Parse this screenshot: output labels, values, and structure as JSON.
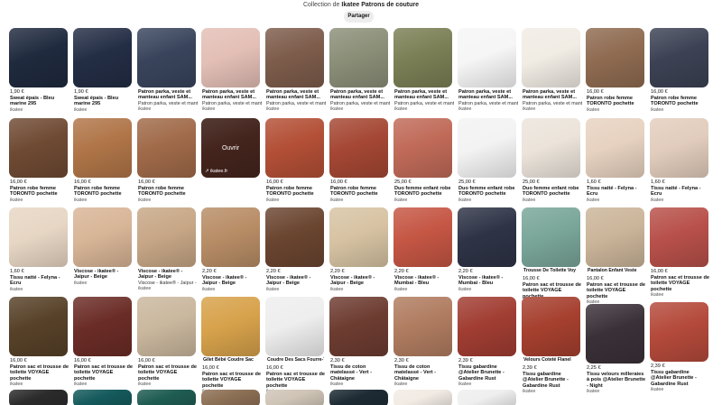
{
  "header": {
    "collection_prefix": "Collection de",
    "collection_name": "Ikatee Patrons de couture",
    "share_label": "Partager"
  },
  "pins_open_label": "Ouvrir",
  "pins_source_domain": "ikatee.fr",
  "columns": [
    [
      {
        "color": "#1f2a3e",
        "price": "1,90 €",
        "title": "Sweat épais - Bleu marine 295",
        "desc": "",
        "source": "ikatee"
      },
      {
        "color": "#6f4a33",
        "price": "16,00 €",
        "title": "Patron robe femme TORONTO pochette",
        "desc": "",
        "source": "ikatee"
      },
      {
        "color": "#e7d6c4",
        "price": "1,60 €",
        "title": "Tissu natté - Felyna - Ecru",
        "desc": "",
        "source": "ikatee"
      },
      {
        "color": "#574128",
        "price": "16,00 €",
        "title": "Patron sac et trousse de toilette VOYAGE pochette",
        "desc": "",
        "source": "ikatee"
      },
      {
        "color": "#2b2b2b",
        "price": "",
        "title": "",
        "desc": "",
        "source": ""
      }
    ],
    [
      {
        "color": "#232d44",
        "price": "1,90 €",
        "title": "Sweat épais - Bleu marine 295",
        "desc": "",
        "source": "ikatee"
      },
      {
        "color": "#b07548",
        "price": "16,00 €",
        "title": "Patron robe femme TORONTO pochette",
        "desc": "",
        "source": "ikatee"
      },
      {
        "color": "#d8b597",
        "price": "",
        "title": "Viscose - ikatee® - Jaipur - Beige",
        "desc": "",
        "source": "ikatee"
      },
      {
        "color": "#6b2c26",
        "price": "16,00 €",
        "title": "Patron sac et trousse de toilette VOYAGE pochette",
        "desc": "",
        "source": "ikatee"
      },
      {
        "color": "#155a5c",
        "price": "",
        "title": "",
        "desc": "",
        "source": ""
      }
    ],
    [
      {
        "color": "#39445c",
        "price": "",
        "title": "Patron parka, veste et manteau enfant SAM...",
        "desc": "Patron parka, veste et manteau enfant SAM...",
        "source": "ikatee"
      },
      {
        "color": "#a06a49",
        "price": "16,00 €",
        "title": "Patron robe femme TORONTO pochette",
        "desc": "",
        "source": "ikatee"
      },
      {
        "color": "#c7a786",
        "price": "",
        "title": "Viscose - ikatee® - Jaipur - Beige",
        "desc": "Viscose - ikatee® - Jaipur - Beige",
        "source": "ikatee"
      },
      {
        "color": "#cab79e",
        "price": "16,00 €",
        "title": "Patron sac et trousse de toilette VOYAGE pochette",
        "desc": "",
        "source": "ikatee"
      },
      {
        "color": "#1f5c52",
        "price": "",
        "title": "",
        "desc": "",
        "source": ""
      }
    ],
    [
      {
        "color": "#e3bfb6",
        "price": "",
        "title": "Patron parka, veste et manteau enfant SAM...",
        "desc": "Patron parka, veste et manteau enfant SAM...",
        "source": "ikatee"
      },
      {
        "color": "#6e3b2f",
        "price": "",
        "title": "",
        "desc": "",
        "source": ""
      },
      {
        "color": "#b88d66",
        "price": "2,20 €",
        "title": "Viscose - ikatee® - Jaipur - Beige",
        "desc": "",
        "source": "ikatee"
      },
      {
        "color": "#d7a24b",
        "tag": "Gilet Bébé   Coudre Sac",
        "price": "16,00 €",
        "title": "Patron sac et trousse de toilette VOYAGE pochette",
        "desc": "",
        "source": "ikatee"
      },
      {
        "color": "#8c6f54",
        "price": "",
        "title": "",
        "desc": "",
        "source": ""
      }
    ],
    [
      {
        "color": "#7d5c4b",
        "price": "",
        "title": "Patron parka, veste et manteau enfant SAM...",
        "desc": "Patron parka, veste et manteau enfant SAM...",
        "source": "ikatee"
      },
      {
        "color": "#b34f36",
        "price": "16,00 €",
        "title": "Patron robe femme TORONTO pochette",
        "desc": "",
        "source": "ikatee"
      },
      {
        "color": "#6a4530",
        "price": "2,20 €",
        "title": "Viscose - ikatee® - Jaipur - Beige",
        "desc": "",
        "source": "ikatee"
      },
      {
        "color": "#eeeeee",
        "tag": "Coudre Des Sacs Fourre-T",
        "price": "16,00 €",
        "title": "Patron sac et trousse de toilette VOYAGE pochette",
        "desc": "",
        "source": "ikatee"
      },
      {
        "color": "#cfc4b6",
        "price": "",
        "title": "",
        "desc": "",
        "source": ""
      }
    ],
    [
      {
        "color": "#8b8f78",
        "price": "",
        "title": "Patron parka, veste et manteau enfant SAM...",
        "desc": "Patron parka, veste et manteau enfant SAM...",
        "source": "ikatee"
      },
      {
        "color": "#a54734",
        "price": "16,00 €",
        "title": "Patron robe femme TORONTO pochette",
        "desc": "",
        "source": "ikatee"
      },
      {
        "color": "#d7c3a3",
        "price": "2,20 €",
        "title": "Viscose - ikatee® - Jaipur - Beige",
        "desc": "",
        "source": "ikatee"
      },
      {
        "color": "#6d3c31",
        "price": "2,30 €",
        "title": "Tissu de coton matelassé - Vert - Châtaigne",
        "desc": "",
        "source": "ikatee"
      },
      {
        "color": "#1d2b34",
        "price": "",
        "title": "",
        "desc": "",
        "source": ""
      }
    ],
    [
      {
        "color": "#7b7f55",
        "price": "",
        "title": "Patron parka, veste et manteau enfant SAM...",
        "desc": "Patron parka, veste et manteau enfant SAM...",
        "source": "ikatee"
      },
      {
        "color": "#c06a58",
        "price": "25,00 €",
        "title": "Duo femme enfant robe TORONTO pochette",
        "desc": "",
        "source": "ikatee"
      },
      {
        "color": "#c55644",
        "price": "2,20 €",
        "title": "Viscose - ikatee® - Mumbai - Bleu",
        "desc": "",
        "source": "ikatee"
      },
      {
        "color": "#b07c60",
        "price": "2,30 €",
        "title": "Tissu de coton matelassé - Vert - Châtaigne",
        "desc": "",
        "source": "ikatee"
      },
      {
        "color": "#f2ebe4",
        "price": "",
        "title": "",
        "desc": "",
        "source": ""
      }
    ],
    [
      {
        "color": "#f6f6f6",
        "price": "",
        "title": "Patron parka, veste et manteau enfant SAM...",
        "desc": "Patron parka, veste et manteau enfant SAM...",
        "source": "ikatee"
      },
      {
        "color": "#f3f3f3",
        "price": "25,00 €",
        "title": "Duo femme enfant robe TORONTO pochette",
        "desc": "",
        "source": "ikatee"
      },
      {
        "color": "#2e3346",
        "price": "2,20 €",
        "title": "Viscose - ikatee® - Mumbai - Bleu",
        "desc": "",
        "source": "ikatee"
      },
      {
        "color": "#a13d32",
        "price": "2,39 €",
        "title": "Tissu gabardine @Atelier Brunette - Gabardine Rust",
        "desc": "",
        "source": "ikatee"
      },
      {
        "color": "#efefef",
        "price": "",
        "title": "",
        "desc": "",
        "source": ""
      }
    ],
    [
      {
        "color": "#f1ece4",
        "price": "",
        "title": "Patron parka, veste et manteau enfant SAM...",
        "desc": "Patron parka, veste et manteau enfant SAM...",
        "source": "ikatee"
      },
      {
        "color": "#ece4db",
        "price": "25,00 €",
        "title": "Duo femme enfant robe TORONTO pochette",
        "desc": "",
        "source": "ikatee"
      },
      {
        "color": "#7aa69a",
        "tag": "Trousse De Toilette Voy",
        "price": "16,00 €",
        "title": "Patron sac et trousse de toilette VOYAGE pochette",
        "desc": "",
        "source": "ikatee"
      },
      {
        "color": "#a6402f",
        "tag": "Velours Coteté   Flanel",
        "price": "2,39 €",
        "title": "Tissu gabardine @Atelier Brunette - Gabardine Rust",
        "desc": "",
        "source": "ikatee"
      }
    ],
    [
      {
        "color": "#8f6b51",
        "price": "16,00 €",
        "title": "Patron robe femme TORONTO pochette",
        "desc": "",
        "source": "ikatee"
      },
      {
        "color": "#e7d2c0",
        "price": "1,60 €",
        "title": "Tissu natté - Felyna - Ecru",
        "desc": "",
        "source": "ikatee"
      },
      {
        "color": "#cbb59a",
        "tag": "Pantalon Enfant   Veste",
        "price": "16,00 €",
        "title": "Patron sac et trousse de toilette VOYAGE pochette",
        "desc": "",
        "source": "ikatee"
      },
      {
        "color": "#3a3138",
        "price": "2,25 €",
        "title": "Tissu velours milleraies à pois @Atelier Brunette - Night",
        "desc": "",
        "source": "ikatee"
      }
    ],
    [
      {
        "color": "#3c4254",
        "price": "16,00 €",
        "title": "Patron robe femme TORONTO pochette",
        "desc": "",
        "source": "ikatee"
      },
      {
        "color": "#e2cdbd",
        "price": "1,60 €",
        "title": "Tissu natté - Felyna - Ecru",
        "desc": "",
        "source": "ikatee"
      },
      {
        "color": "#b8504a",
        "price": "16,00 €",
        "title": "Patron sac et trousse de toilette VOYAGE pochette",
        "desc": "",
        "source": "ikatee"
      },
      {
        "color": "#b44a3b",
        "price": "2,39 €",
        "title": "Tissu gabardine @Atelier Brunette - Gabardine Rust",
        "desc": "",
        "source": "ikatee"
      }
    ]
  ]
}
